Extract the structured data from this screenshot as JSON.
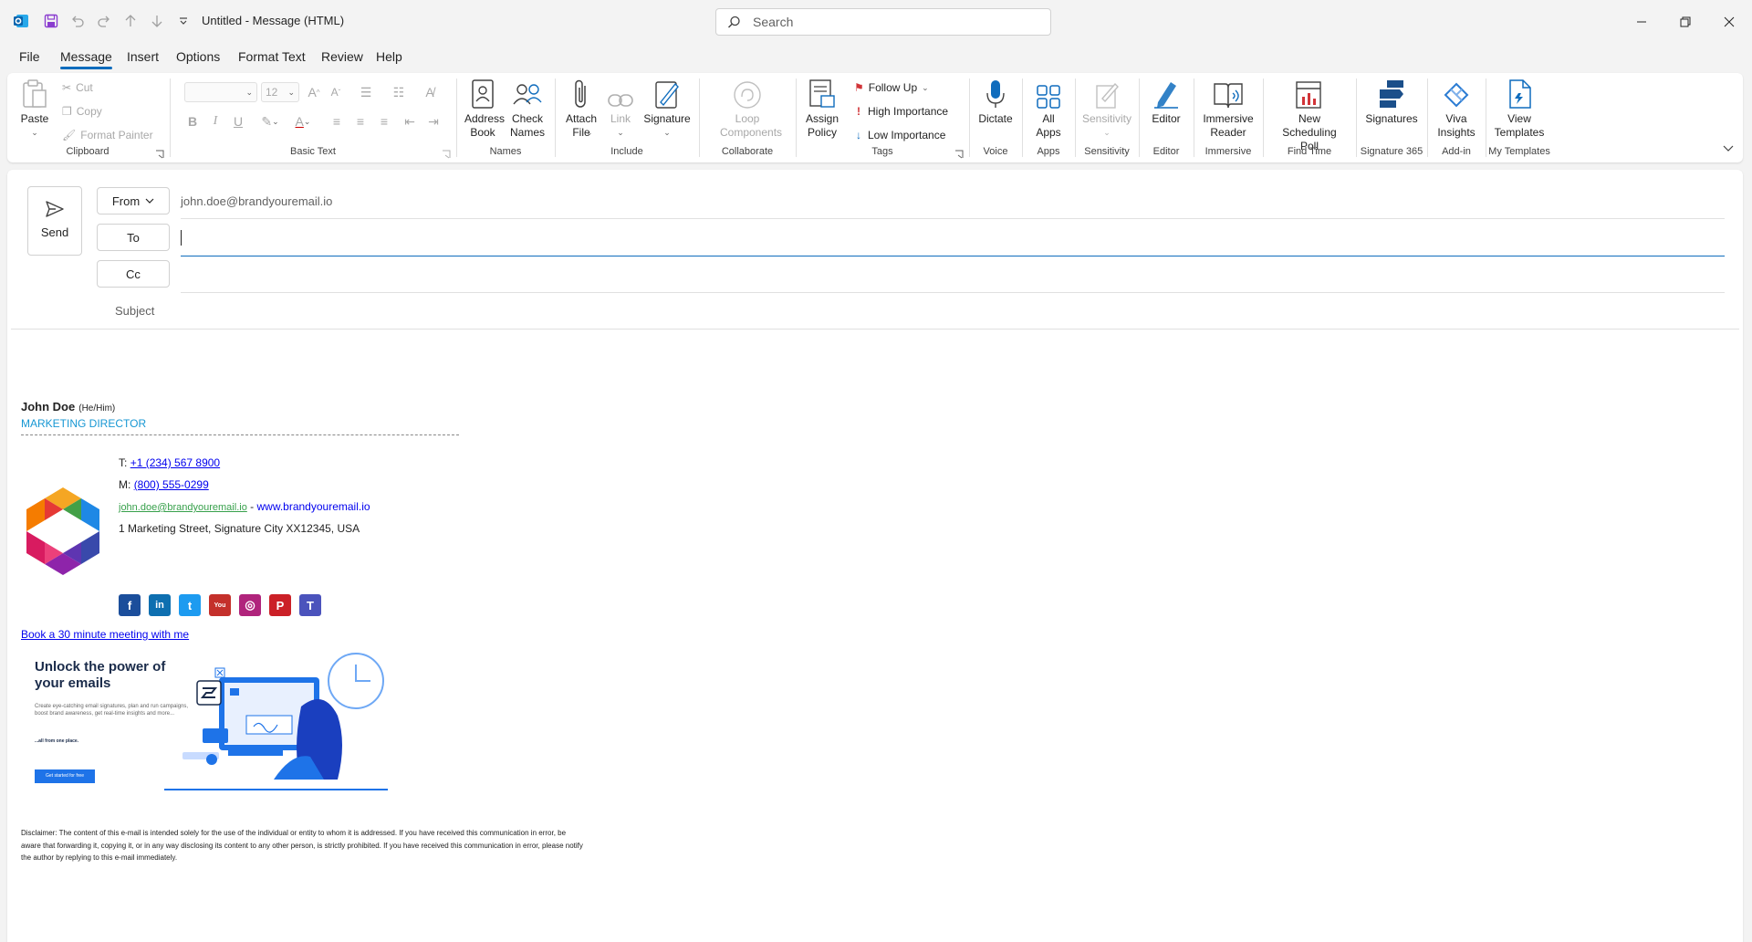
{
  "titlebar": {
    "title": "Untitled  -  Message (HTML)",
    "search_placeholder": "Search",
    "icons": [
      "outlook-icon",
      "save-icon",
      "undo-icon",
      "redo-icon",
      "up-arrow-icon",
      "down-arrow-icon",
      "customize-qat-icon"
    ]
  },
  "menu": {
    "tabs": [
      "File",
      "Message",
      "Insert",
      "Options",
      "Format Text",
      "Review",
      "Help"
    ],
    "active": "Message"
  },
  "ribbon": {
    "clipboard": {
      "paste": "Paste",
      "cut": "Cut",
      "copy": "Copy",
      "format_painter": "Format Painter",
      "label": "Clipboard"
    },
    "basic_text": {
      "font_size": "12",
      "label": "Basic Text"
    },
    "names": {
      "address_book": "Address Book",
      "check_names": "Check Names",
      "label": "Names"
    },
    "include": {
      "attach_file": "Attach File",
      "link": "Link",
      "signature": "Signature",
      "label": "Include"
    },
    "collaborate": {
      "loop_components": "Loop Components",
      "label": "Collaborate"
    },
    "tags": {
      "assign_policy": "Assign Policy",
      "follow_up": "Follow Up",
      "high_importance": "High Importance",
      "low_importance": "Low Importance",
      "label": "Tags"
    },
    "voice": {
      "dictate": "Dictate",
      "label": "Voice"
    },
    "apps": {
      "all_apps": "All Apps",
      "label": "Apps"
    },
    "sensitivity": {
      "sensitivity": "Sensitivity",
      "label": "Sensitivity"
    },
    "editor": {
      "editor": "Editor",
      "label": "Editor"
    },
    "immersive": {
      "immersive_reader": "Immersive Reader",
      "label": "Immersive"
    },
    "find_time": {
      "new_scheduling_poll": "New Scheduling Poll",
      "label": "Find Time"
    },
    "signature365": {
      "signatures": "Signatures",
      "label": "Signature 365"
    },
    "addin": {
      "viva_insights": "Viva Insights",
      "label": "Add-in"
    },
    "my_templates": {
      "view_templates": "View Templates",
      "label": "My Templates"
    }
  },
  "compose": {
    "send": "Send",
    "from_label": "From",
    "from_value": "john.doe@brandyouremail.io",
    "to_label": "To",
    "to_value": "",
    "cc_label": "Cc",
    "cc_value": "",
    "subject_label": "Subject",
    "subject_value": ""
  },
  "signature": {
    "name": "John Doe",
    "pronouns": "(He/Him)",
    "title": "MARKETING DIRECTOR",
    "phone_label": "T:",
    "phone": "+1 (234) 567 8900",
    "mobile_label": "M:",
    "mobile": "(800) 555-0299",
    "email": "john.doe@brandyouremail.io",
    "separator": " - ",
    "website": "www.brandyouremail.io",
    "address": "1 Marketing Street, Signature City XX12345, USA",
    "social": [
      {
        "name": "facebook",
        "glyph": "f",
        "color": "#1b4e9b"
      },
      {
        "name": "linkedin",
        "glyph": "in",
        "color": "#0e6fb0"
      },
      {
        "name": "twitter",
        "glyph": "t",
        "color": "#1d9bf0"
      },
      {
        "name": "youtube",
        "glyph": "You",
        "color": "#c4302b"
      },
      {
        "name": "instagram",
        "glyph": "◎",
        "color": "#b0247c"
      },
      {
        "name": "pinterest",
        "glyph": "P",
        "color": "#cb2027"
      },
      {
        "name": "teams",
        "glyph": "T",
        "color": "#4b53bc"
      }
    ],
    "meeting_link": "Book a 30 minute meeting with me",
    "banner": {
      "headline": "Unlock the power of your emails",
      "body": "Create eye-catching email signatures, plan and run campaigns, boost brand awareness, get real-time insights and more...",
      "tagline": "...all from one place.",
      "cta": "Get started for free"
    },
    "disclaimer": "Disclaimer: The content of this e-mail is intended solely for the use of the individual or entity to whom it is addressed. If you have received this communication in error, be aware that forwarding it, copying it, or in any way disclosing its content to any other person, is strictly prohibited. If you have received this communication in error, please notify the author by replying to this e-mail immediately."
  },
  "colors": {
    "accent": "#0f6cbd",
    "signature_title": "#1797d3",
    "banner_blue": "#1e73e8"
  }
}
